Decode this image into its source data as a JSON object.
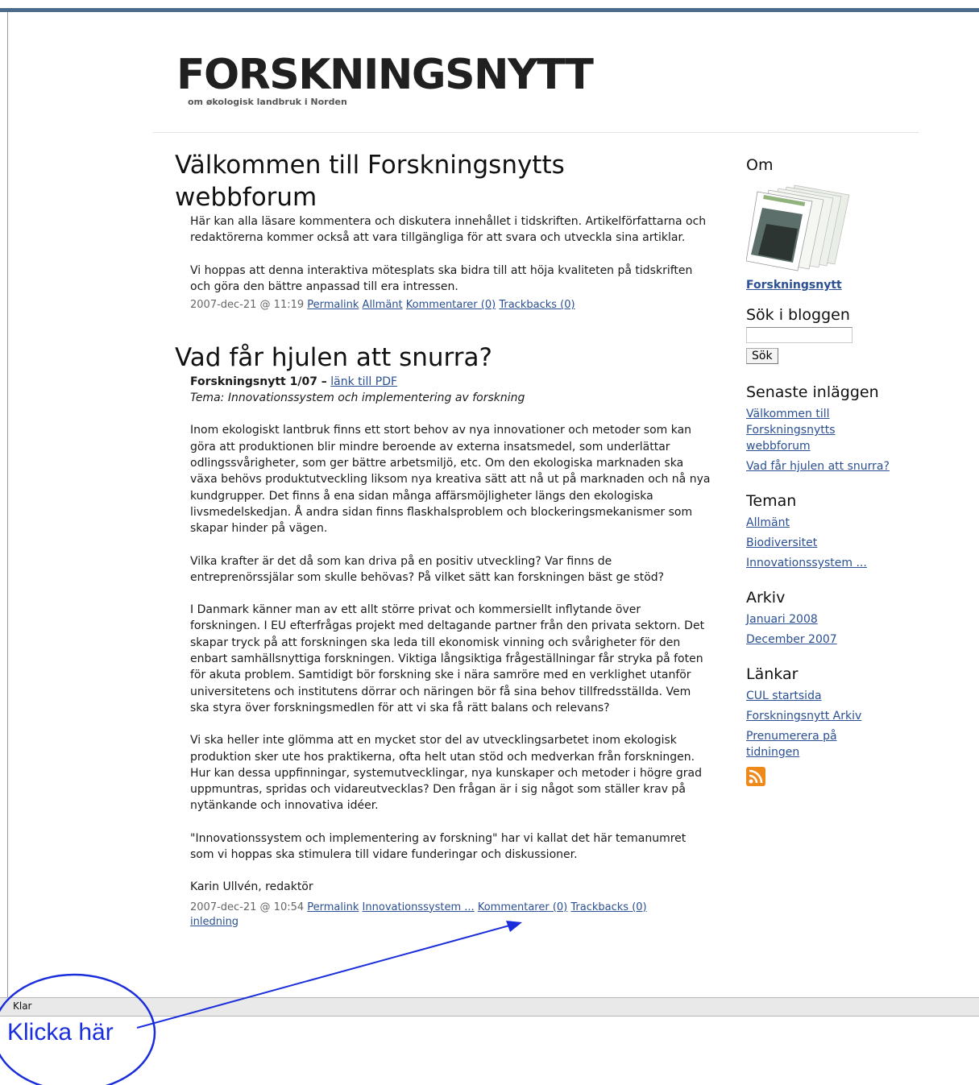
{
  "site": {
    "title": "FORSKNINGSNYTT",
    "tagline": "om økologisk landbruk i Norden"
  },
  "posts": [
    {
      "title": "Välkommen till Forskningsnytts webbforum",
      "paragraphs": [
        "Här kan alla läsare kommentera och diskutera innehållet i tidskriften. Artikelförfattarna och redaktörerna kommer också att vara tillgängliga för att svara och utveckla sina artiklar.",
        "Vi hoppas att denna interaktiva mötesplats ska bidra till att höja kvaliteten på tidskriften och göra den bättre anpassad till era intressen."
      ],
      "meta_date": "2007-dec-21 @ 11:19",
      "links": {
        "permalink": "Permalink",
        "category": "Allmänt",
        "comments": "Kommentarer (0)",
        "trackbacks": "Trackbacks (0)"
      }
    },
    {
      "title": "Vad får hjulen att snurra?",
      "issue_label": "Forskningsnytt 1/07 –",
      "pdf_link": "länk till PDF",
      "theme_line": "Tema: Innovationssystem och implementering av forskning",
      "paragraphs": [
        "Inom ekologiskt lantbruk finns ett stort behov av nya innovationer och metoder som kan göra att produktionen blir mindre beroende av externa insatsmedel, som underlättar odlingssvårigheter, som ger bättre arbetsmiljö, etc. Om den ekologiska marknaden ska växa behövs produktutveckling liksom nya kreativa sätt att nå ut på marknaden och nå nya kundgrupper. Det finns å ena sidan många affärsmöjligheter längs den ekologiska livsmedelskedjan. Å andra sidan finns flaskhalsproblem och blockeringsmekanismer som skapar hinder på vägen.",
        "Vilka krafter är det då som kan driva på en positiv utveckling? Var finns de entreprenörssjälar som skulle behövas? På vilket sätt kan forskningen bäst ge stöd?",
        "I Danmark känner man av ett allt större privat och kommersiellt inflytande över forskningen. I EU efterfrågas projekt med deltagande partner från den privata sektorn. Det skapar tryck på att forskningen ska leda till ekonomisk vinning och svårigheter för den enbart samhällsnyttiga forskningen. Viktiga långsiktiga frågeställningar får stryka på foten för akuta problem. Samtidigt bör forskning ske i nära samröre med en verklighet utanför universitetens och institutens dörrar och näringen bör få sina behov tillfredsställda. Vem ska styra över forskningsmedlen för att vi ska få rätt balans och relevans?",
        "Vi ska heller inte glömma att en mycket stor del av utvecklingsarbetet inom ekologisk produktion sker ute hos praktikerna, ofta helt utan stöd och medverkan från forskningen. Hur kan dessa uppfinningar, systemutvecklingar, nya kunskaper och metoder i högre grad uppmuntras, spridas och vidareutvecklas? Den frågan är i sig något som ställer krav på nytänkande och innovativa idéer.",
        "\"Innovationssystem och implementering av forskning\" har vi kallat det här temanumret som vi hoppas ska stimulera till vidare funderingar och diskussioner.",
        "Karin Ullvén, redaktör"
      ],
      "meta_date": "2007-dec-21 @ 10:54",
      "links": {
        "permalink": "Permalink",
        "category": "Innovationssystem ...",
        "comments": "Kommentarer (0)",
        "trackbacks": "Trackbacks (0)",
        "tag": "inledning"
      }
    }
  ],
  "sidebar": {
    "om": {
      "heading": "Om",
      "link": "Forskningsnytt"
    },
    "search": {
      "heading": "Sök i bloggen",
      "button": "Sök",
      "value": ""
    },
    "recent": {
      "heading": "Senaste inläggen",
      "items": [
        "Välkommen till Forskningsnytts webbforum",
        "Vad får hjulen att snurra?"
      ]
    },
    "themes": {
      "heading": "Teman",
      "items": [
        "Allmänt",
        "Biodiversitet",
        "Innovationssystem ..."
      ]
    },
    "archive": {
      "heading": "Arkiv",
      "items": [
        "Januari 2008",
        "December 2007"
      ]
    },
    "links": {
      "heading": "Länkar",
      "items": [
        "CUL startsida",
        "Forskningsnytt Arkiv",
        "Prenumerera på tidningen"
      ]
    },
    "rss_icon": "rss-feed-icon",
    "rss_color": "#ee8a1b"
  },
  "statusbar": {
    "text": "Klar"
  },
  "annotation": {
    "text": "Klicka här",
    "color": "#1a2edb"
  }
}
